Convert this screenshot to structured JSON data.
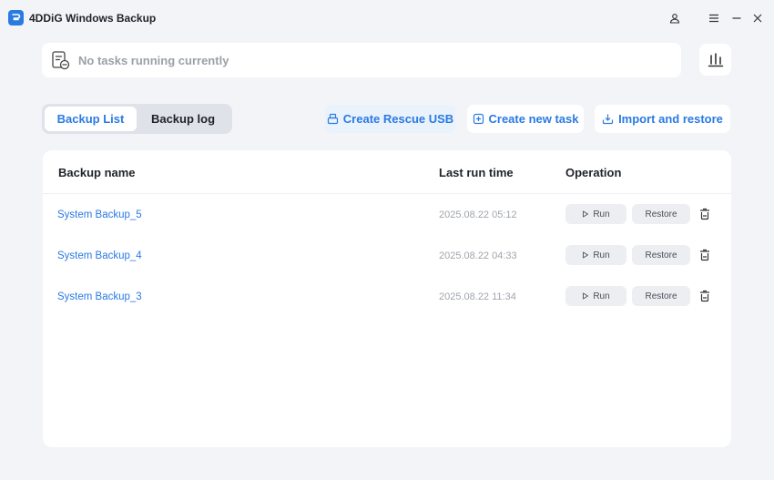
{
  "app": {
    "title": "4DDiG Windows Backup",
    "accent_color": "#2a7ae2"
  },
  "status": {
    "text": "No tasks running currently",
    "icon": "task-document-icon"
  },
  "tabs": [
    {
      "label": "Backup List",
      "active": true
    },
    {
      "label": "Backup log",
      "active": false
    }
  ],
  "actions": {
    "rescue_usb": "Create Rescue USB",
    "new_task": "Create new task",
    "import_restore": "Import and restore"
  },
  "table": {
    "columns": [
      "Backup name",
      "Last run time",
      "Operation"
    ],
    "rows": [
      {
        "name": "System Backup_5",
        "time": "2025.08.22 05:12"
      },
      {
        "name": "System Backup_4",
        "time": "2025.08.22 04:33"
      },
      {
        "name": "System Backup_3",
        "time": "2025.08.22 11:34"
      }
    ],
    "run_label": "Run",
    "restore_label": "Restore"
  }
}
